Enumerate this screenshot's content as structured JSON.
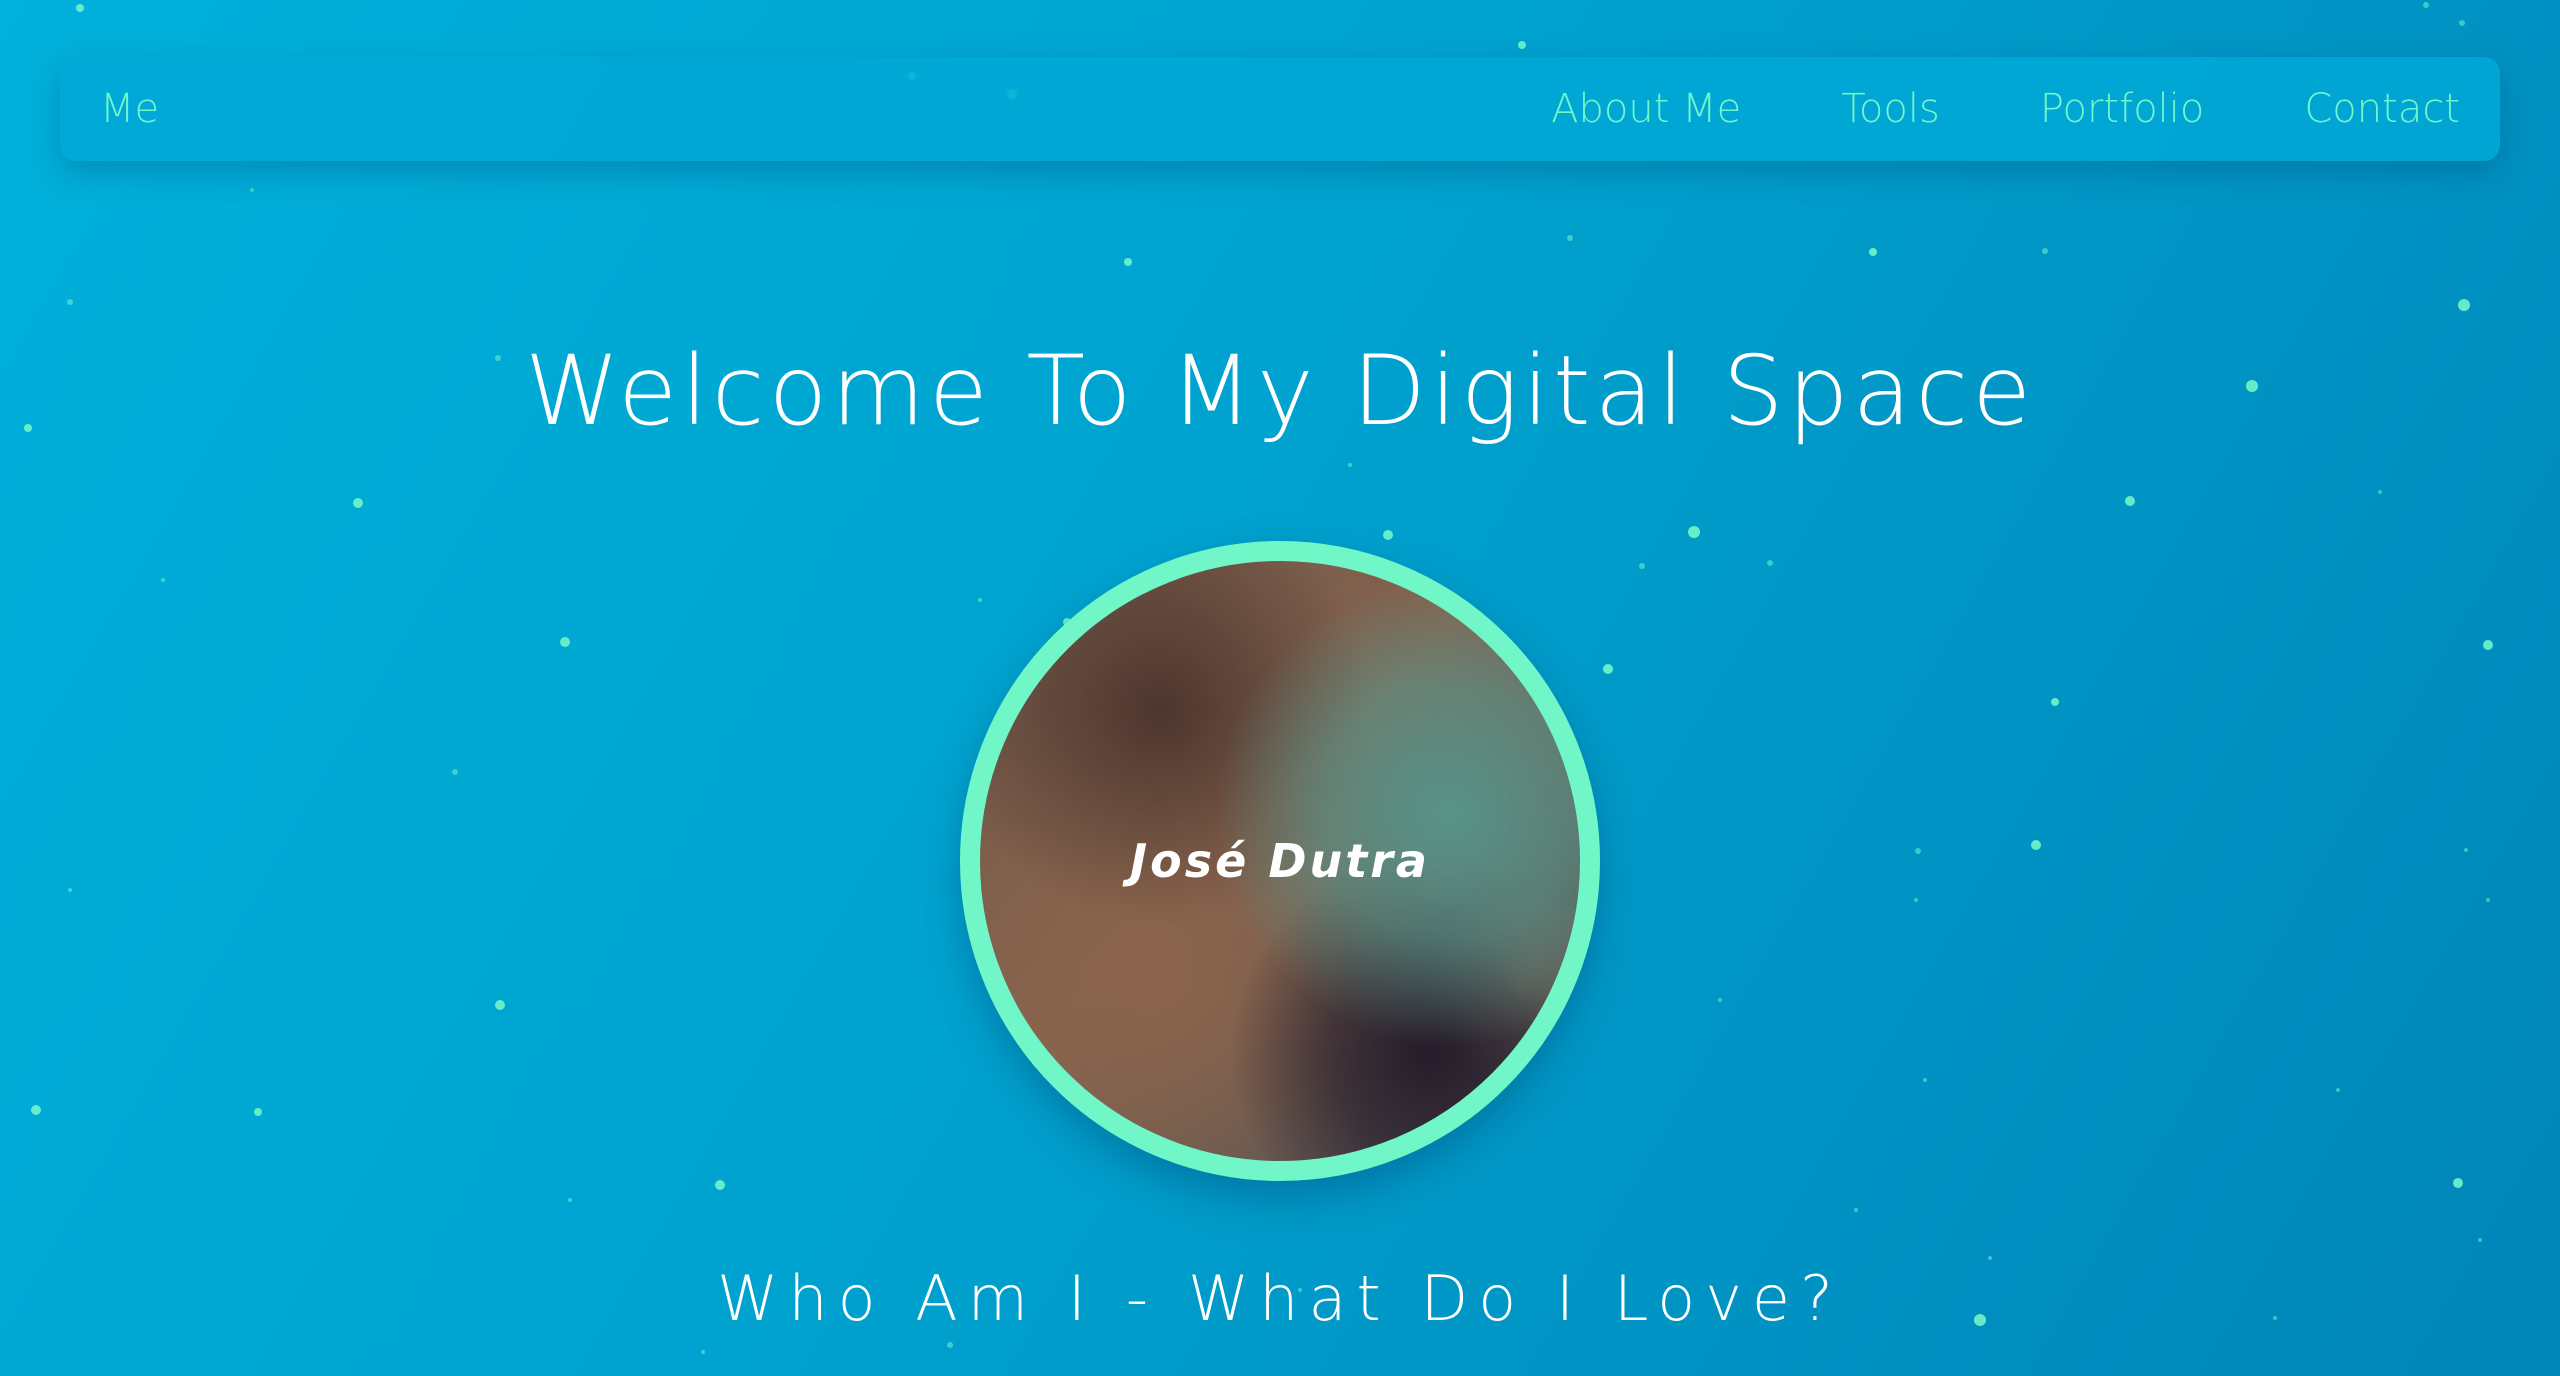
{
  "nav": {
    "brand": "Me",
    "links": [
      "About Me",
      "Tools",
      "Portfolio",
      "Contact"
    ]
  },
  "hero": {
    "title": "Welcome To My Digital Space",
    "avatar_name": "José Dutra",
    "subtitle": "Who Am I - What Do I Love?"
  },
  "colors": {
    "accent": "#70f6c7",
    "background_start": "#00b1db",
    "background_end": "#0085b8",
    "text": "#ffffff"
  },
  "icons": {
    "background_particles": "star-particles"
  }
}
